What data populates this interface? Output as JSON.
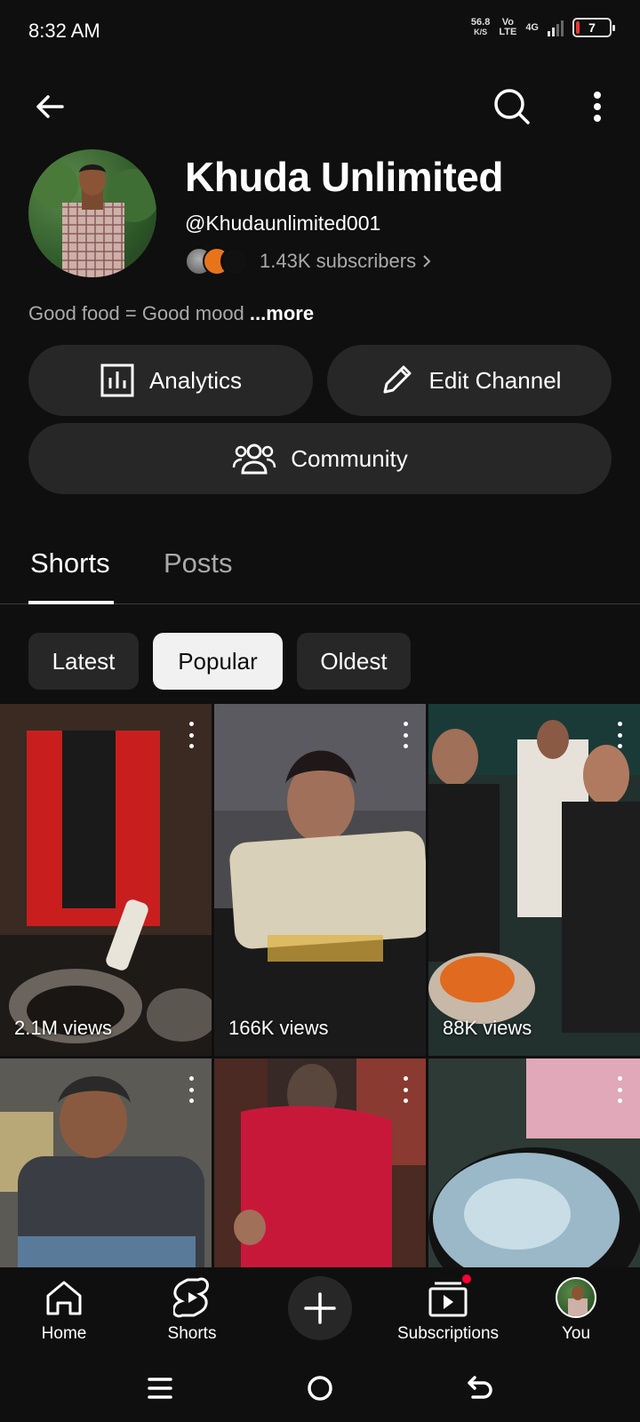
{
  "status": {
    "time": "8:32 AM",
    "speed_value": "56.8",
    "speed_unit": "K/S",
    "volte_top": "Vo",
    "volte_bottom": "LTE",
    "network": "4G",
    "battery": "7"
  },
  "channel": {
    "name": "Khuda Unlimited",
    "handle": "@Khudaunlimited001",
    "subscribers": "1.43K subscribers",
    "description": "Good food = Good mood",
    "more": "...more"
  },
  "actions": {
    "analytics": "Analytics",
    "edit_channel": "Edit Channel",
    "community": "Community"
  },
  "tabs": [
    {
      "label": "Shorts",
      "active": true
    },
    {
      "label": "Posts",
      "active": false
    }
  ],
  "chips": [
    {
      "label": "Latest",
      "active": false
    },
    {
      "label": "Popular",
      "active": true
    },
    {
      "label": "Oldest",
      "active": false
    }
  ],
  "shorts": [
    {
      "views": "2.1M views"
    },
    {
      "views": "166K views"
    },
    {
      "views": "88K views"
    },
    {
      "views": ""
    },
    {
      "views": ""
    },
    {
      "views": ""
    }
  ],
  "bottom_nav": {
    "home": "Home",
    "shorts": "Shorts",
    "subscriptions": "Subscriptions",
    "you": "You"
  },
  "colors": {
    "background": "#0f0f0f",
    "surface": "#272727",
    "notification": "#ff0033",
    "battery_low": "#e53935"
  }
}
